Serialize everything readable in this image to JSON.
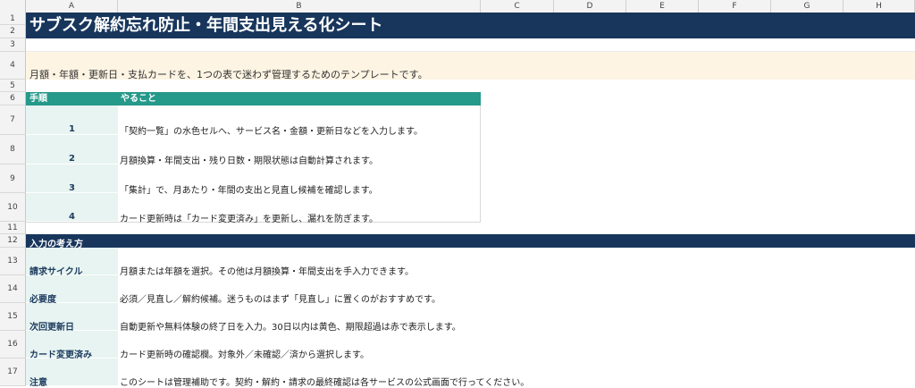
{
  "columns": [
    "A",
    "B",
    "C",
    "D",
    "E",
    "F",
    "G",
    "H"
  ],
  "rows": [
    "1",
    "2",
    "3",
    "4",
    "5",
    "6",
    "7",
    "8",
    "9",
    "10",
    "11",
    "12",
    "13",
    "14",
    "15",
    "16",
    "17"
  ],
  "title": "サブスク解約忘れ防止・年間支出見える化シート",
  "intro": "月額・年額・更新日・支払カードを、1つの表で迷わず管理するためのテンプレートです。",
  "steps_header": {
    "col_a": "手順",
    "col_b": "やること"
  },
  "steps": [
    {
      "num": "1",
      "text": "「契約一覧」の水色セルへ、サービス名・金額・更新日などを入力します。"
    },
    {
      "num": "2",
      "text": "月額換算・年間支出・残り日数・期限状態は自動計算されます。"
    },
    {
      "num": "3",
      "text": "「集計」で、月あたり・年間の支出と見直し候補を確認します。"
    },
    {
      "num": "4",
      "text": "カード更新時は「カード変更済み」を更新し、漏れを防ぎます。"
    }
  ],
  "section_title": "入力の考え方",
  "guide": [
    {
      "label": "請求サイクル",
      "text": "月額または年額を選択。その他は月額換算・年間支出を手入力できます。"
    },
    {
      "label": "必要度",
      "text": "必須／見直し／解約候補。迷うものはまず「見直し」に置くのがおすすめです。"
    },
    {
      "label": "次回更新日",
      "text": "自動更新や無料体験の終了日を入力。30日以内は黄色、期限超過は赤で表示します。"
    },
    {
      "label": "カード変更済み",
      "text": "カード更新時の確認欄。対象外／未確認／済から選択します。"
    },
    {
      "label": "注意",
      "text": "このシートは管理補助です。契約・解約・請求の最終確認は各サービスの公式画面で行ってください。"
    }
  ],
  "colors": {
    "navy": "#18365c",
    "teal": "#25998a",
    "mint": "#e7f4f1",
    "cream": "#fdf4e3"
  }
}
